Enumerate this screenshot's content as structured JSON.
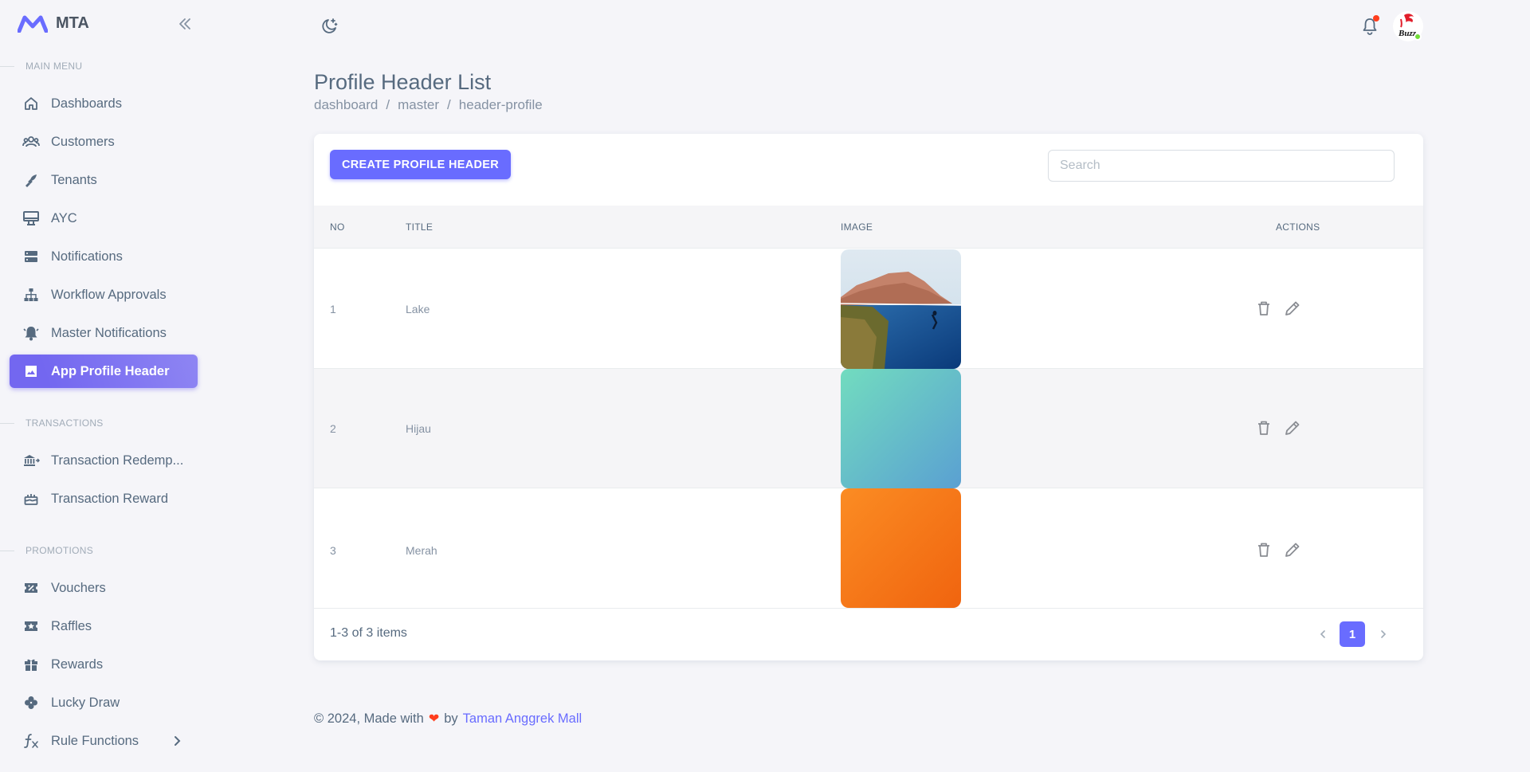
{
  "brand": {
    "name": "MTA"
  },
  "sidebar": {
    "sections": {
      "main": "MAIN MENU",
      "transactions": "TRANSACTIONS",
      "promotions": "PROMOTIONS"
    },
    "items": [
      {
        "label": "Dashboards",
        "icon": "home-icon"
      },
      {
        "label": "Customers",
        "icon": "users-icon"
      },
      {
        "label": "Tenants",
        "icon": "tenants-icon"
      },
      {
        "label": "AYC",
        "icon": "monitor-icon"
      },
      {
        "label": "Notifications",
        "icon": "server-icon"
      },
      {
        "label": "Workflow Approvals",
        "icon": "sitemap-icon"
      },
      {
        "label": "Master Notifications",
        "icon": "bell-ring-icon"
      },
      {
        "label": "App Profile Header",
        "icon": "image-icon",
        "active": true
      },
      {
        "label": "Transaction Redemp...",
        "icon": "bank-icon"
      },
      {
        "label": "Transaction Reward",
        "icon": "cake-icon"
      },
      {
        "label": "Vouchers",
        "icon": "voucher-icon"
      },
      {
        "label": "Raffles",
        "icon": "star-ticket-icon"
      },
      {
        "label": "Rewards",
        "icon": "gift-icon"
      },
      {
        "label": "Lucky Draw",
        "icon": "clover-icon"
      },
      {
        "label": "Rule Functions",
        "icon": "function-icon"
      }
    ]
  },
  "avatar": {
    "text": "Buzz"
  },
  "page": {
    "title": "Profile Header List",
    "breadcrumb": [
      "dashboard",
      "master",
      "header-profile"
    ]
  },
  "toolbar": {
    "create_label": "CREATE PROFILE HEADER",
    "search_placeholder": "Search"
  },
  "table": {
    "columns": [
      "NO",
      "TITLE",
      "IMAGE",
      "ACTIONS"
    ],
    "rows": [
      {
        "no": "1",
        "title": "Lake",
        "image": "lake-photo"
      },
      {
        "no": "2",
        "title": "Hijau",
        "image": "green-gradient"
      },
      {
        "no": "3",
        "title": "Merah",
        "image": "orange-gradient"
      }
    ],
    "items_info": "1-3 of 3 items",
    "current_page": "1"
  },
  "colors": {
    "accent": "#696cff",
    "active_menu": "#7367f0",
    "green_gradient": [
      "#72dcbf",
      "#5aa0d2"
    ],
    "orange_gradient": [
      "#fb8c23",
      "#f0640f"
    ]
  },
  "footer": {
    "prefix": "© 2024, Made with",
    "by": "by",
    "link": "Taman Anggrek Mall"
  }
}
